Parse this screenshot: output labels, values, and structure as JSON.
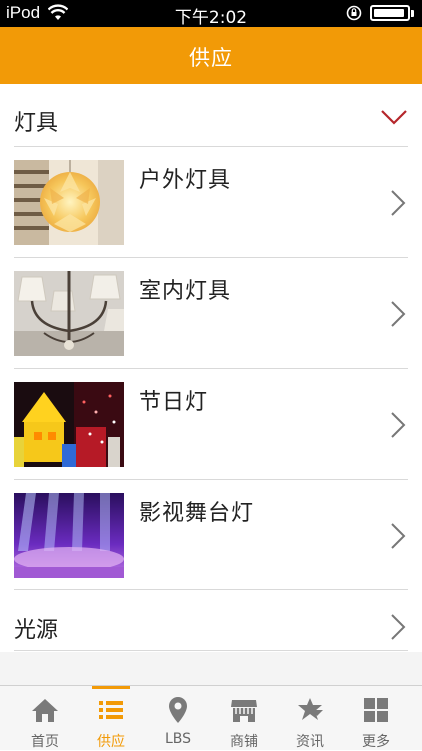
{
  "status_bar": {
    "carrier": "iPod",
    "time": "下午2:02",
    "battery_level": 0.95
  },
  "nav": {
    "title": "供应"
  },
  "category": {
    "label": "灯具",
    "expanded": true,
    "accent": "#b5262b"
  },
  "items": [
    {
      "label": "户外灯具",
      "icon": "pendant-lamp-photo"
    },
    {
      "label": "室内灯具",
      "icon": "chandelier-photo"
    },
    {
      "label": "节日灯",
      "icon": "festival-lights-photo"
    },
    {
      "label": "影视舞台灯",
      "icon": "stage-lights-photo"
    }
  ],
  "source": {
    "label": "光源"
  },
  "tabs": [
    {
      "label": "首页",
      "icon": "home-icon",
      "active": false
    },
    {
      "label": "供应",
      "icon": "list-icon",
      "active": true
    },
    {
      "label": "LBS",
      "icon": "location-pin-icon",
      "active": false
    },
    {
      "label": "商铺",
      "icon": "store-icon",
      "active": false
    },
    {
      "label": "资讯",
      "icon": "news-icon",
      "active": false
    },
    {
      "label": "更多",
      "icon": "grid-icon",
      "active": false
    }
  ],
  "colors": {
    "brand": "#f29a07",
    "tab_inactive": "#666666"
  }
}
